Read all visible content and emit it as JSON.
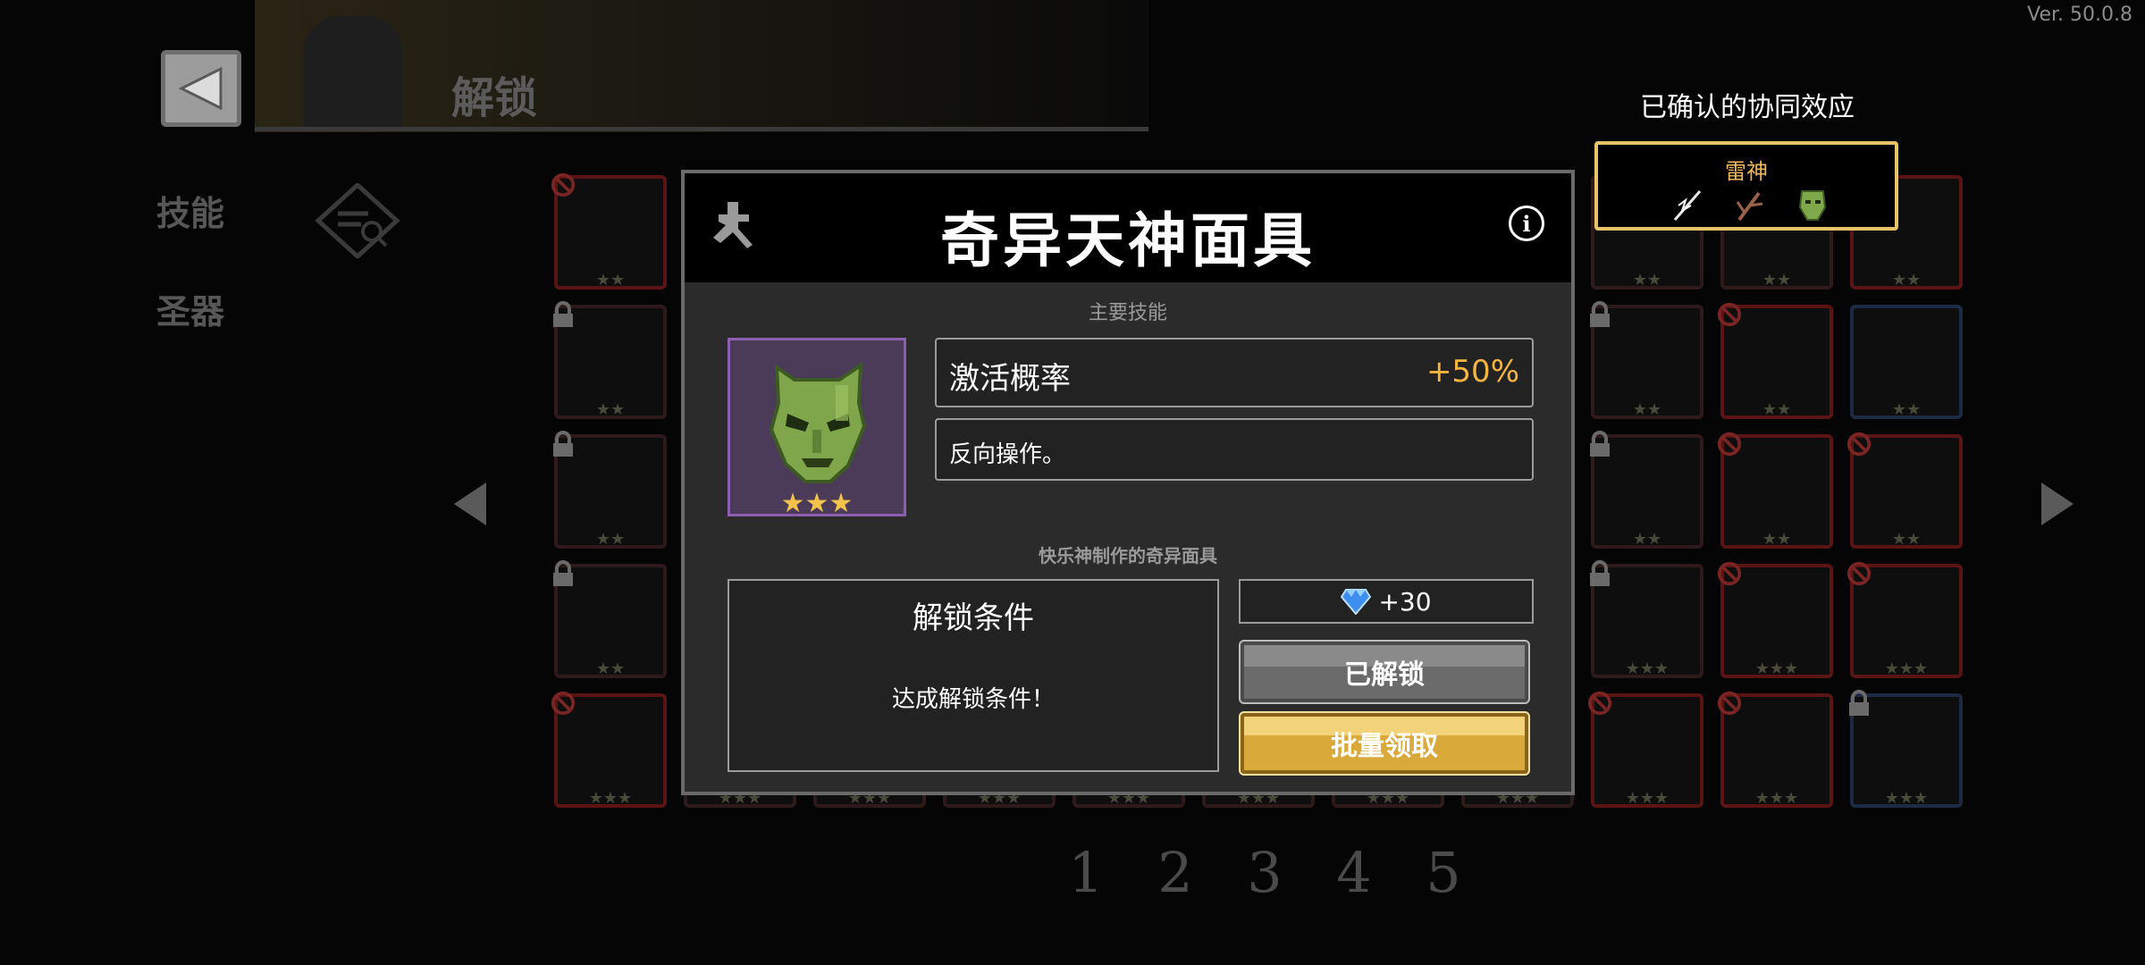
{
  "version": "Ver. 50.0.8",
  "header": {
    "title": "解锁"
  },
  "side_tabs": [
    {
      "label": "技能"
    },
    {
      "label": "圣器"
    }
  ],
  "pagination": {
    "pages": [
      "1",
      "2",
      "3",
      "4",
      "5"
    ]
  },
  "grid": {
    "rows": [
      [
        {
          "state": "blocked",
          "stars": "★★"
        },
        {
          "state": "normal",
          "stars": "★★"
        },
        {
          "state": "normal",
          "stars": "★★"
        },
        {
          "state": "normal",
          "stars": "★★"
        },
        {
          "state": "normal",
          "stars": "★★"
        },
        {
          "state": "normal",
          "stars": "★★"
        },
        {
          "state": "normal",
          "stars": "★★"
        },
        {
          "state": "normal",
          "stars": "★★"
        },
        {
          "state": "normal",
          "stars": "★★"
        },
        {
          "state": "normal",
          "stars": "★★"
        },
        {
          "state": "blocked",
          "stars": "★★"
        }
      ],
      [
        {
          "state": "locked",
          "stars": "★★"
        },
        {
          "state": "normal",
          "stars": "★★"
        },
        {
          "state": "normal",
          "stars": "★★"
        },
        {
          "state": "normal",
          "stars": "★★"
        },
        {
          "state": "normal",
          "stars": "★★"
        },
        {
          "state": "locked",
          "stars": "★★"
        },
        {
          "state": "normal",
          "stars": "★★"
        },
        {
          "state": "normal",
          "stars": "★★"
        },
        {
          "state": "locked",
          "stars": "★★"
        },
        {
          "state": "blocked",
          "stars": "★★"
        },
        {
          "state": "normal",
          "stars": "★★"
        }
      ],
      [
        {
          "state": "locked",
          "stars": "★★"
        },
        {
          "state": "normal",
          "stars": "★★"
        },
        {
          "state": "normal",
          "stars": "★★"
        },
        {
          "state": "normal",
          "stars": "★★"
        },
        {
          "state": "normal",
          "stars": "★★"
        },
        {
          "state": "normal",
          "stars": "★★"
        },
        {
          "state": "normal",
          "stars": "★★"
        },
        {
          "state": "normal",
          "stars": "★★"
        },
        {
          "state": "locked",
          "stars": "★★"
        },
        {
          "state": "blocked",
          "stars": "★★"
        },
        {
          "state": "blocked",
          "stars": "★★"
        }
      ],
      [
        {
          "state": "locked",
          "stars": "★★"
        },
        {
          "state": "normal",
          "stars": "★★★"
        },
        {
          "state": "normal",
          "stars": "★★★"
        },
        {
          "state": "normal",
          "stars": "★★★"
        },
        {
          "state": "normal",
          "stars": "★★★"
        },
        {
          "state": "normal",
          "stars": "★★★"
        },
        {
          "state": "normal",
          "stars": "★★★"
        },
        {
          "state": "normal",
          "stars": "★★★"
        },
        {
          "state": "locked",
          "stars": "★★★"
        },
        {
          "state": "blocked",
          "stars": "★★★"
        },
        {
          "state": "blocked",
          "stars": "★★★"
        }
      ],
      [
        {
          "state": "blocked",
          "stars": "★★★"
        },
        {
          "state": "locked",
          "stars": "★★★"
        },
        {
          "state": "normal",
          "stars": "★★★"
        },
        {
          "state": "normal",
          "stars": "★★★"
        },
        {
          "state": "normal",
          "stars": "★★★"
        },
        {
          "state": "normal",
          "stars": "★★★"
        },
        {
          "state": "normal",
          "stars": "★★★"
        },
        {
          "state": "normal",
          "stars": "★★★"
        },
        {
          "state": "blocked",
          "stars": "★★★"
        },
        {
          "state": "blocked",
          "stars": "★★★"
        },
        {
          "state": "locked",
          "stars": "★★★"
        }
      ]
    ]
  },
  "synergy": {
    "title": "已确认的协同效应",
    "name": "雷神",
    "icons": [
      "lightning-sword-icon",
      "branch-icon",
      "mask-icon"
    ]
  },
  "modal": {
    "title": "奇异天神面具",
    "section_main": "主要技能",
    "item_stars": "★★★",
    "stat_label": "激活概率",
    "stat_value": "+50%",
    "description": "反向操作。",
    "flavor_text": "快乐神制作的奇异面具",
    "unlock_title": "解锁条件",
    "unlock_desc": "达成解锁条件！",
    "reward_text": "+30",
    "unlocked_button": "已解锁",
    "claim_button": "批量领取"
  },
  "colors": {
    "accent_gold": "#f5b540",
    "synergy_border": "#e8c36a",
    "item_frame_purple": "#8c5fb0",
    "claim_button": "#d9a93a"
  }
}
